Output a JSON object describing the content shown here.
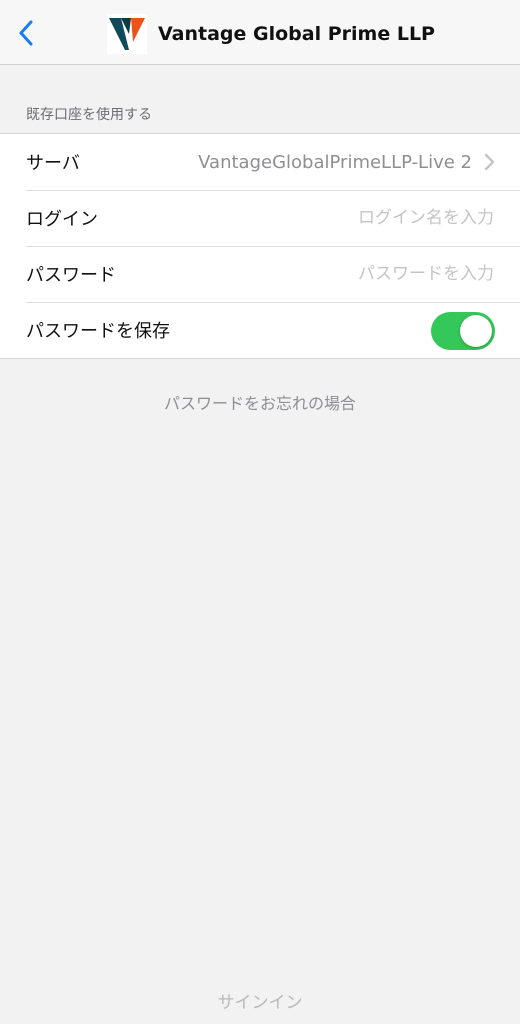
{
  "navbar": {
    "back_icon": "chevron-left-icon",
    "title": "Vantage Global Prime LLP",
    "logo_icon": "vantage-logo-icon",
    "accent_color": "#1a7cf2"
  },
  "section": {
    "header": "既存口座を使用する"
  },
  "form": {
    "server": {
      "label": "サーバ",
      "value": "VantageGlobalPrimeLLP-Live 2"
    },
    "login": {
      "label": "ログイン",
      "placeholder": "ログイン名を入力",
      "value": ""
    },
    "password": {
      "label": "パスワード",
      "placeholder": "パスワードを入力",
      "value": ""
    },
    "save_password": {
      "label": "パスワードを保存",
      "enabled": true,
      "toggle_color": "#34c759"
    }
  },
  "forgot_password": "パスワードをお忘れの場合",
  "sign_in": "サインイン"
}
